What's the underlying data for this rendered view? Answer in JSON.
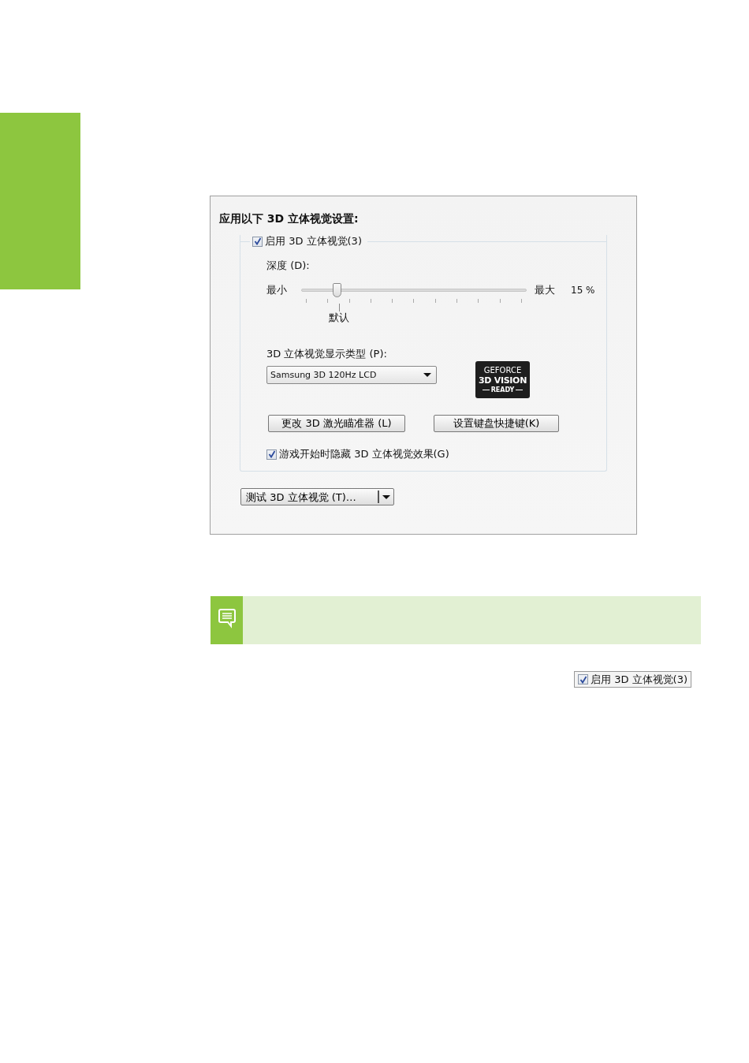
{
  "dialog": {
    "heading": "应用以下 3D 立体视觉设置:",
    "enable_group": {
      "label": "启用 3D 立体视觉(3)",
      "checked": true
    },
    "depth": {
      "label": "深度 (D):",
      "min_label": "最小",
      "max_label": "最大",
      "level": 0.16,
      "reading": "15 %",
      "default_label": "默认"
    },
    "display_type": {
      "label": "3D 立体视觉显示类型 (P):",
      "value": "Samsung 3D 120Hz LCD"
    },
    "logo": {
      "line_1": "GEFORCE",
      "line_2": "3D VISION",
      "line_3": "READY"
    },
    "buttons": [
      "更改 3D 激光瞄准器 (L)",
      "设置键盘快捷键(K)"
    ],
    "hide_checkbox": {
      "label": "游戏开始时隐藏 3D 立体视觉效果(G)",
      "checked": true
    },
    "test_button": {
      "label": "测试 3D 立体视觉 (T)…"
    }
  },
  "inline_checkbox": {
    "label": "启用 3D 立体视觉(3)",
    "checked": true
  }
}
